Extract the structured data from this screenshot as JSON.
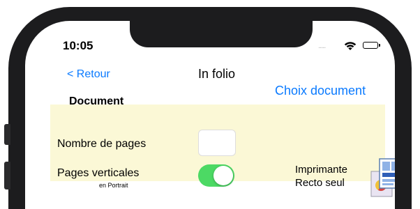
{
  "status_bar": {
    "time": "10:05",
    "signal": "....."
  },
  "nav": {
    "back_label": "< Retour",
    "title": "In folio",
    "choose_document_label": "Choix document"
  },
  "section": {
    "title": "Document"
  },
  "settings": {
    "pages_count_label": "Nombre de pages",
    "pages_count_value": "",
    "vertical_pages_label": "Pages verticales",
    "vertical_pages_sublabel": "en Portrait",
    "vertical_pages_on": true,
    "printer_label_line1": "Imprimante",
    "printer_label_line2": "Recto seul"
  },
  "colors": {
    "accent": "#0a7aff",
    "toggle_on": "#4cd964",
    "panel_bg": "#fbf8d6"
  },
  "icons": [
    "wifi-icon",
    "battery-icon",
    "printer-duplex-icon"
  ]
}
